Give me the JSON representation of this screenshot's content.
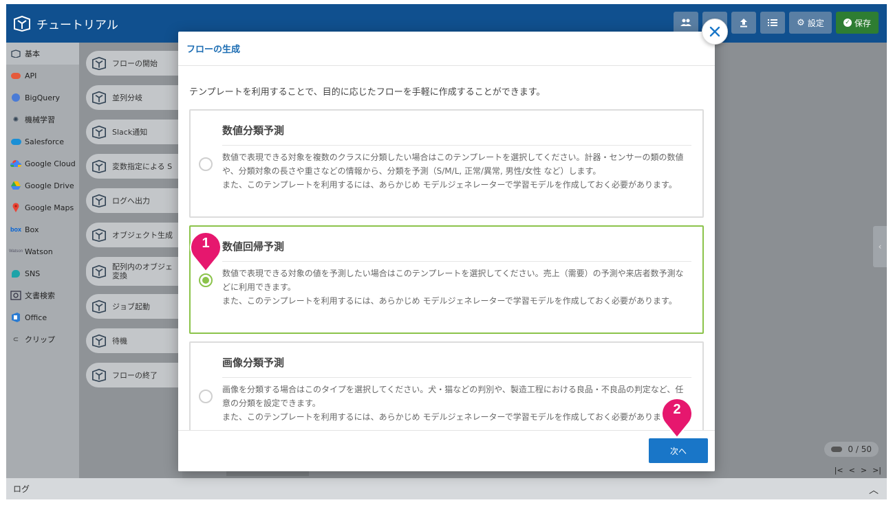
{
  "app": {
    "title": "チュートリアル",
    "header_buttons": [
      "users",
      "upload",
      "list"
    ],
    "settings_label": "設定",
    "save_label": "保存"
  },
  "sidebar": {
    "items": [
      {
        "label": "基本",
        "icon": "box-icon"
      },
      {
        "label": "API",
        "icon": "api-icon"
      },
      {
        "label": "BigQuery",
        "icon": "bigquery-icon"
      },
      {
        "label": "機械学習",
        "icon": "brain-icon"
      },
      {
        "label": "Salesforce",
        "icon": "salesforce-icon"
      },
      {
        "label": "Google Cloud",
        "icon": "google-cloud-icon"
      },
      {
        "label": "Google Drive",
        "icon": "google-drive-icon"
      },
      {
        "label": "Google Maps",
        "icon": "map-pin-icon"
      },
      {
        "label": "Box",
        "icon": "box-brand-icon"
      },
      {
        "label": "Watson",
        "icon": "watson-icon"
      },
      {
        "label": "SNS",
        "icon": "chat-icon"
      },
      {
        "label": "文書検索",
        "icon": "document-search-icon"
      },
      {
        "label": "Office",
        "icon": "office-icon"
      },
      {
        "label": "クリップ",
        "icon": "paperclip-icon"
      }
    ]
  },
  "palette": {
    "items": [
      {
        "label": "フローの開始"
      },
      {
        "label": "並列分岐"
      },
      {
        "label": "Slack通知"
      },
      {
        "label": "変数指定による S"
      },
      {
        "label": "ログへ出力"
      },
      {
        "label": "オブジェクト生成"
      },
      {
        "label": "配列内のオブジェ 変換"
      },
      {
        "label": "ジョブ起動"
      },
      {
        "label": "待機"
      },
      {
        "label": "フローの終了"
      }
    ]
  },
  "canvas": {
    "counter": "0 / 50",
    "pager": [
      "|<",
      "<",
      ">",
      ">|"
    ]
  },
  "log": {
    "label": "ログ"
  },
  "modal": {
    "title": "フローの生成",
    "intro": "テンプレートを利用することで、目的に応じたフローを手軽に作成することができます。",
    "templates": [
      {
        "title": "数値分類予測",
        "desc": "数値で表現できる対象を複数のクラスに分類したい場合はこのテンプレートを選択してください。計器・センサーの類の数値や、分類対象の長さや重さなどの情報から、分類を予測（S/M/L, 正常/異常, 男性/女性 など）します。",
        "note": "また、このテンプレートを利用するには、あらかじめ モデルジェネレーターで学習モデルを作成しておく必要があります。",
        "selected": false
      },
      {
        "title": "数値回帰予測",
        "desc": "数値で表現できる対象の値を予測したい場合はこのテンプレートを選択してください。売上（需要）の予測や来店者数予測などに利用できます。",
        "note": "また、このテンプレートを利用するには、あらかじめ モデルジェネレーターで学習モデルを作成しておく必要があります。",
        "selected": true
      },
      {
        "title": "画像分類予測",
        "desc": "画像を分類する場合はこのタイプを選択してください。犬・猫などの判別や、製造工程における良品・不良品の判定など、任意の分類を設定できます。",
        "note": "また、このテンプレートを利用するには、あらかじめ モデルジェネレーターで学習モデルを作成しておく必要があります。",
        "selected": false
      }
    ],
    "next_label": "次へ",
    "close_icon": "close-icon"
  },
  "markers": [
    {
      "num": "1",
      "color": "#e6176e"
    },
    {
      "num": "2",
      "color": "#e6176e"
    }
  ],
  "colors": {
    "header": "#10508f",
    "accent": "#1976c8",
    "selected": "#8bc34a",
    "marker": "#e6176e"
  }
}
